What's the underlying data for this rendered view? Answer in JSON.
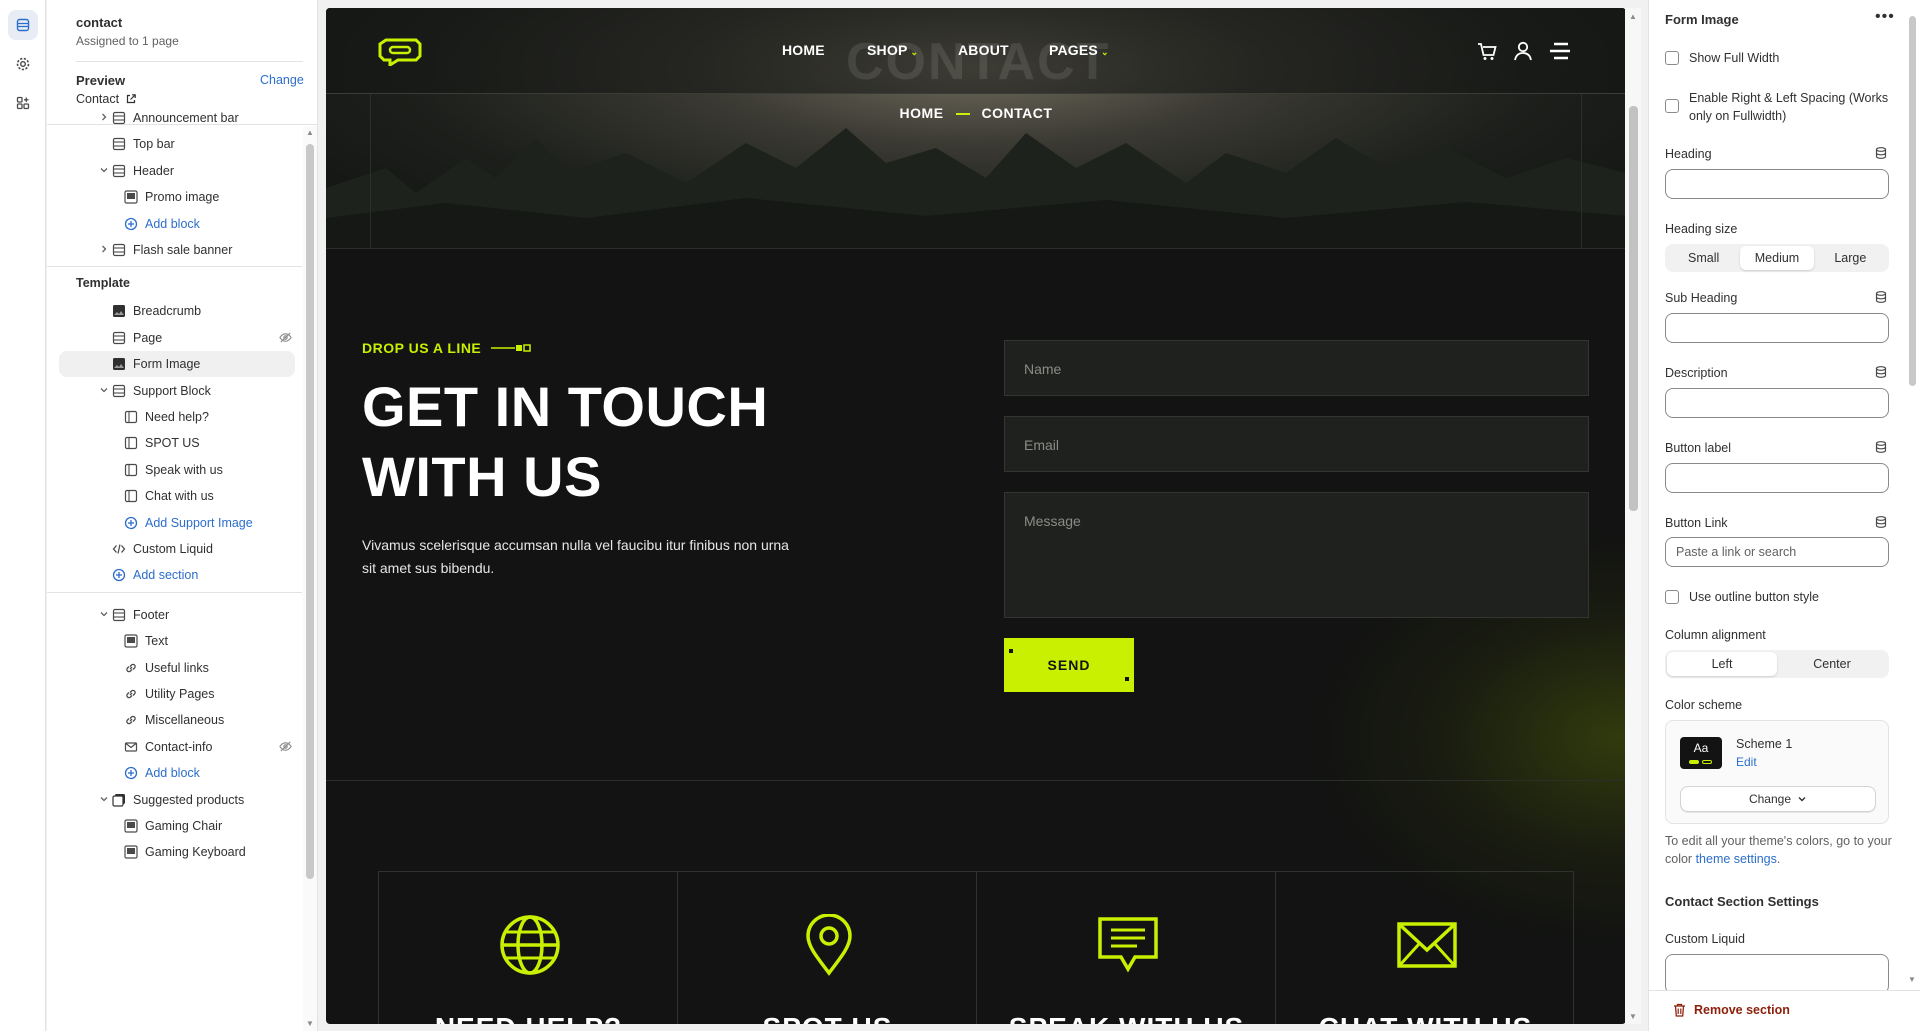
{
  "left_panel": {
    "page_name": "contact",
    "assigned": "Assigned to 1 page",
    "preview_label": "Preview",
    "change_label": "Change",
    "preview_value": "Contact",
    "header_group": [
      {
        "label": "Announcement bar",
        "icon": "section-icon",
        "chevron": true
      },
      {
        "label": "Top bar",
        "icon": "section-icon",
        "chevron": false
      },
      {
        "label": "Header",
        "icon": "section-icon",
        "chevron": true,
        "expanded": true
      },
      {
        "label": "Promo image",
        "icon": "image-block-icon",
        "child": true
      },
      {
        "label": "Add block",
        "icon": "add-icon",
        "child": true,
        "add": true
      },
      {
        "label": "Flash sale banner",
        "icon": "section-icon",
        "chevron": true
      }
    ],
    "template_label": "Template",
    "template_items": [
      {
        "label": "Breadcrumb",
        "icon": "image-section-icon"
      },
      {
        "label": "Page",
        "icon": "section-icon",
        "hidden": true
      },
      {
        "label": "Form Image",
        "icon": "image-section-icon",
        "selected": true
      },
      {
        "label": "Support Block",
        "icon": "section-icon",
        "chevron": true,
        "expanded": true
      },
      {
        "label": "Need help?",
        "icon": "block-icon",
        "child": true
      },
      {
        "label": "SPOT US",
        "icon": "block-icon",
        "child": true
      },
      {
        "label": "Speak with us",
        "icon": "block-icon",
        "child": true
      },
      {
        "label": "Chat with us",
        "icon": "block-icon",
        "child": true
      },
      {
        "label": "Add Support Image",
        "icon": "add-icon",
        "child": true,
        "add": true
      },
      {
        "label": "Custom Liquid",
        "icon": "code-icon"
      },
      {
        "label": "Add section",
        "icon": "add-icon",
        "add": true
      }
    ],
    "footer_group": [
      {
        "label": "Footer",
        "icon": "section-icon",
        "chevron": true,
        "expanded": true
      },
      {
        "label": "Text",
        "icon": "image-block-icon",
        "child": true
      },
      {
        "label": "Useful links",
        "icon": "link-icon",
        "child": true
      },
      {
        "label": "Utility Pages",
        "icon": "link-icon",
        "child": true
      },
      {
        "label": "Miscellaneous",
        "icon": "link-icon",
        "child": true
      },
      {
        "label": "Contact-info",
        "icon": "mail-icon",
        "child": true,
        "hidden": true
      },
      {
        "label": "Add block",
        "icon": "add-icon",
        "child": true,
        "add": true
      },
      {
        "label": "Suggested products",
        "icon": "products-icon",
        "chevron": true,
        "expanded": true
      },
      {
        "label": "Gaming Chair",
        "icon": "image-block-icon",
        "child": true
      },
      {
        "label": "Gaming Keyboard",
        "icon": "image-block-icon",
        "child": true
      }
    ]
  },
  "site": {
    "nav": {
      "home": "HOME",
      "shop": "SHOP",
      "about": "ABOUT",
      "pages": "PAGES"
    },
    "ghost_title": "CONTACT",
    "breadcrumb": {
      "home": "HOME",
      "current": "CONTACT"
    },
    "eyebrow": "DROP US A LINE",
    "heading": "GET IN TOUCH WITH US",
    "lede": "Vivamus scelerisque accumsan nulla vel faucibu itur finibus non urna sit amet sus bibendu.",
    "form": {
      "name_placeholder": "Name",
      "email_placeholder": "Email",
      "message_placeholder": "Message",
      "send": "SEND"
    },
    "cards": [
      {
        "title": "NEED HELP?",
        "icon": "globe-icon"
      },
      {
        "title": "SPOT US",
        "icon": "location-pin-icon"
      },
      {
        "title": "SPEAK WITH US",
        "icon": "chat-bubble-icon"
      },
      {
        "title": "CHAT WITH US",
        "icon": "envelope-icon"
      }
    ],
    "accent": "#c8f000",
    "background": "#121312"
  },
  "right_panel": {
    "title": "Form Image",
    "show_full_width": "Show Full Width",
    "enable_spacing": "Enable Right & Left Spacing (Works only on Fullwidth)",
    "heading_label": "Heading",
    "heading_size_label": "Heading size",
    "heading_sizes": [
      "Small",
      "Medium",
      "Large"
    ],
    "heading_size_selected": "Medium",
    "sub_heading_label": "Sub Heading",
    "description_label": "Description",
    "button_label_label": "Button label",
    "button_link_label": "Button Link",
    "button_link_placeholder": "Paste a link or search",
    "outline_button": "Use outline button style",
    "column_alignment_label": "Column alignment",
    "alignments": [
      "Left",
      "Center"
    ],
    "alignment_selected": "Left",
    "color_scheme_label": "Color scheme",
    "swatch_text": "Aa",
    "scheme_name": "Scheme 1",
    "scheme_edit": "Edit",
    "scheme_change": "Change",
    "hint_prefix": "To edit all your theme's colors, go to your color ",
    "hint_link": "theme settings",
    "hint_suffix": ".",
    "contact_settings": "Contact Section Settings",
    "custom_liquid_label": "Custom Liquid",
    "remove_section": "Remove section"
  }
}
